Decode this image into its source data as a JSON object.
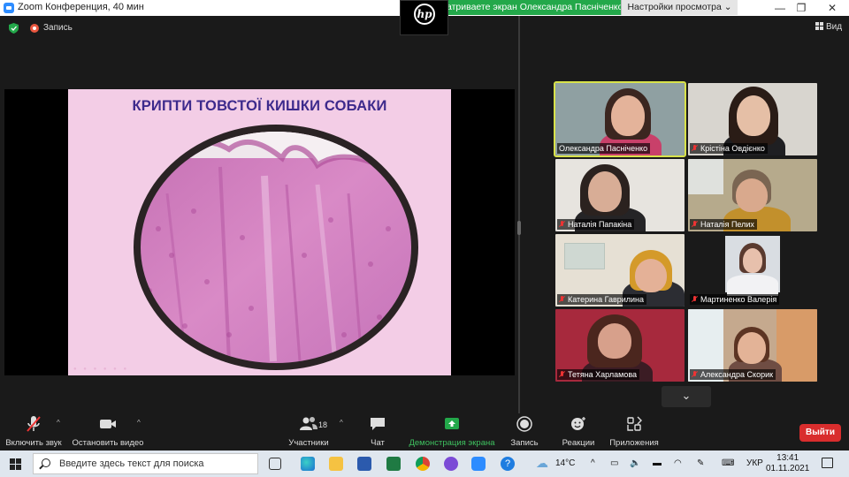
{
  "window": {
    "title": "Zoom Конференция, 40 мин",
    "minimize": "—",
    "maximize": "❐",
    "close": "✕"
  },
  "share_banner": {
    "text": "атриваете экран Олександра  Пасніченко",
    "view_options_label": "Настройки просмотра ⌄"
  },
  "hp_tile": {
    "logo_text": "hp"
  },
  "meeting_bar": {
    "recording_label": "Запись",
    "view_label": "Вид"
  },
  "slide": {
    "title": "КРИПТИ ТОВСТОЇ КИШКИ СОБАКИ"
  },
  "participants": [
    {
      "name": "Олександра  Пасніченко",
      "muted": false,
      "active": true
    },
    {
      "name": "Крістіна Овдієнко",
      "muted": true,
      "active": false
    },
    {
      "name": "Наталія Папакіна",
      "muted": true,
      "active": false
    },
    {
      "name": "Наталія Пелих",
      "muted": true,
      "active": false
    },
    {
      "name": "Катерина Гаврилина",
      "muted": true,
      "active": false
    },
    {
      "name": "Мартиненко Валерія",
      "muted": true,
      "active": false
    },
    {
      "name": "Тетяна Харламова",
      "muted": true,
      "active": false
    },
    {
      "name": "Александра Скорик",
      "muted": true,
      "active": false
    }
  ],
  "gallery": {
    "scroll_icon": "⌄"
  },
  "toolbar": {
    "unmute": "Включить звук",
    "stop_video": "Остановить видео",
    "participants": "Участники",
    "participants_count": "18",
    "chat": "Чат",
    "share_screen": "Демонстрация экрана",
    "record": "Запись",
    "reactions": "Реакции",
    "apps": "Приложения",
    "leave": "Выйти",
    "caret": "^"
  },
  "taskbar": {
    "search_placeholder": "Введите здесь текст для поиска",
    "weather": "14°C",
    "language": "УКР",
    "time": "13:41",
    "date": "01.11.2021"
  },
  "colors": {
    "accent_green": "#23a84a",
    "leave_red": "#d92d2d",
    "slide_bg": "#f3cde6",
    "slide_title": "#3d2a8c",
    "active_speaker": "#d8e24a"
  }
}
